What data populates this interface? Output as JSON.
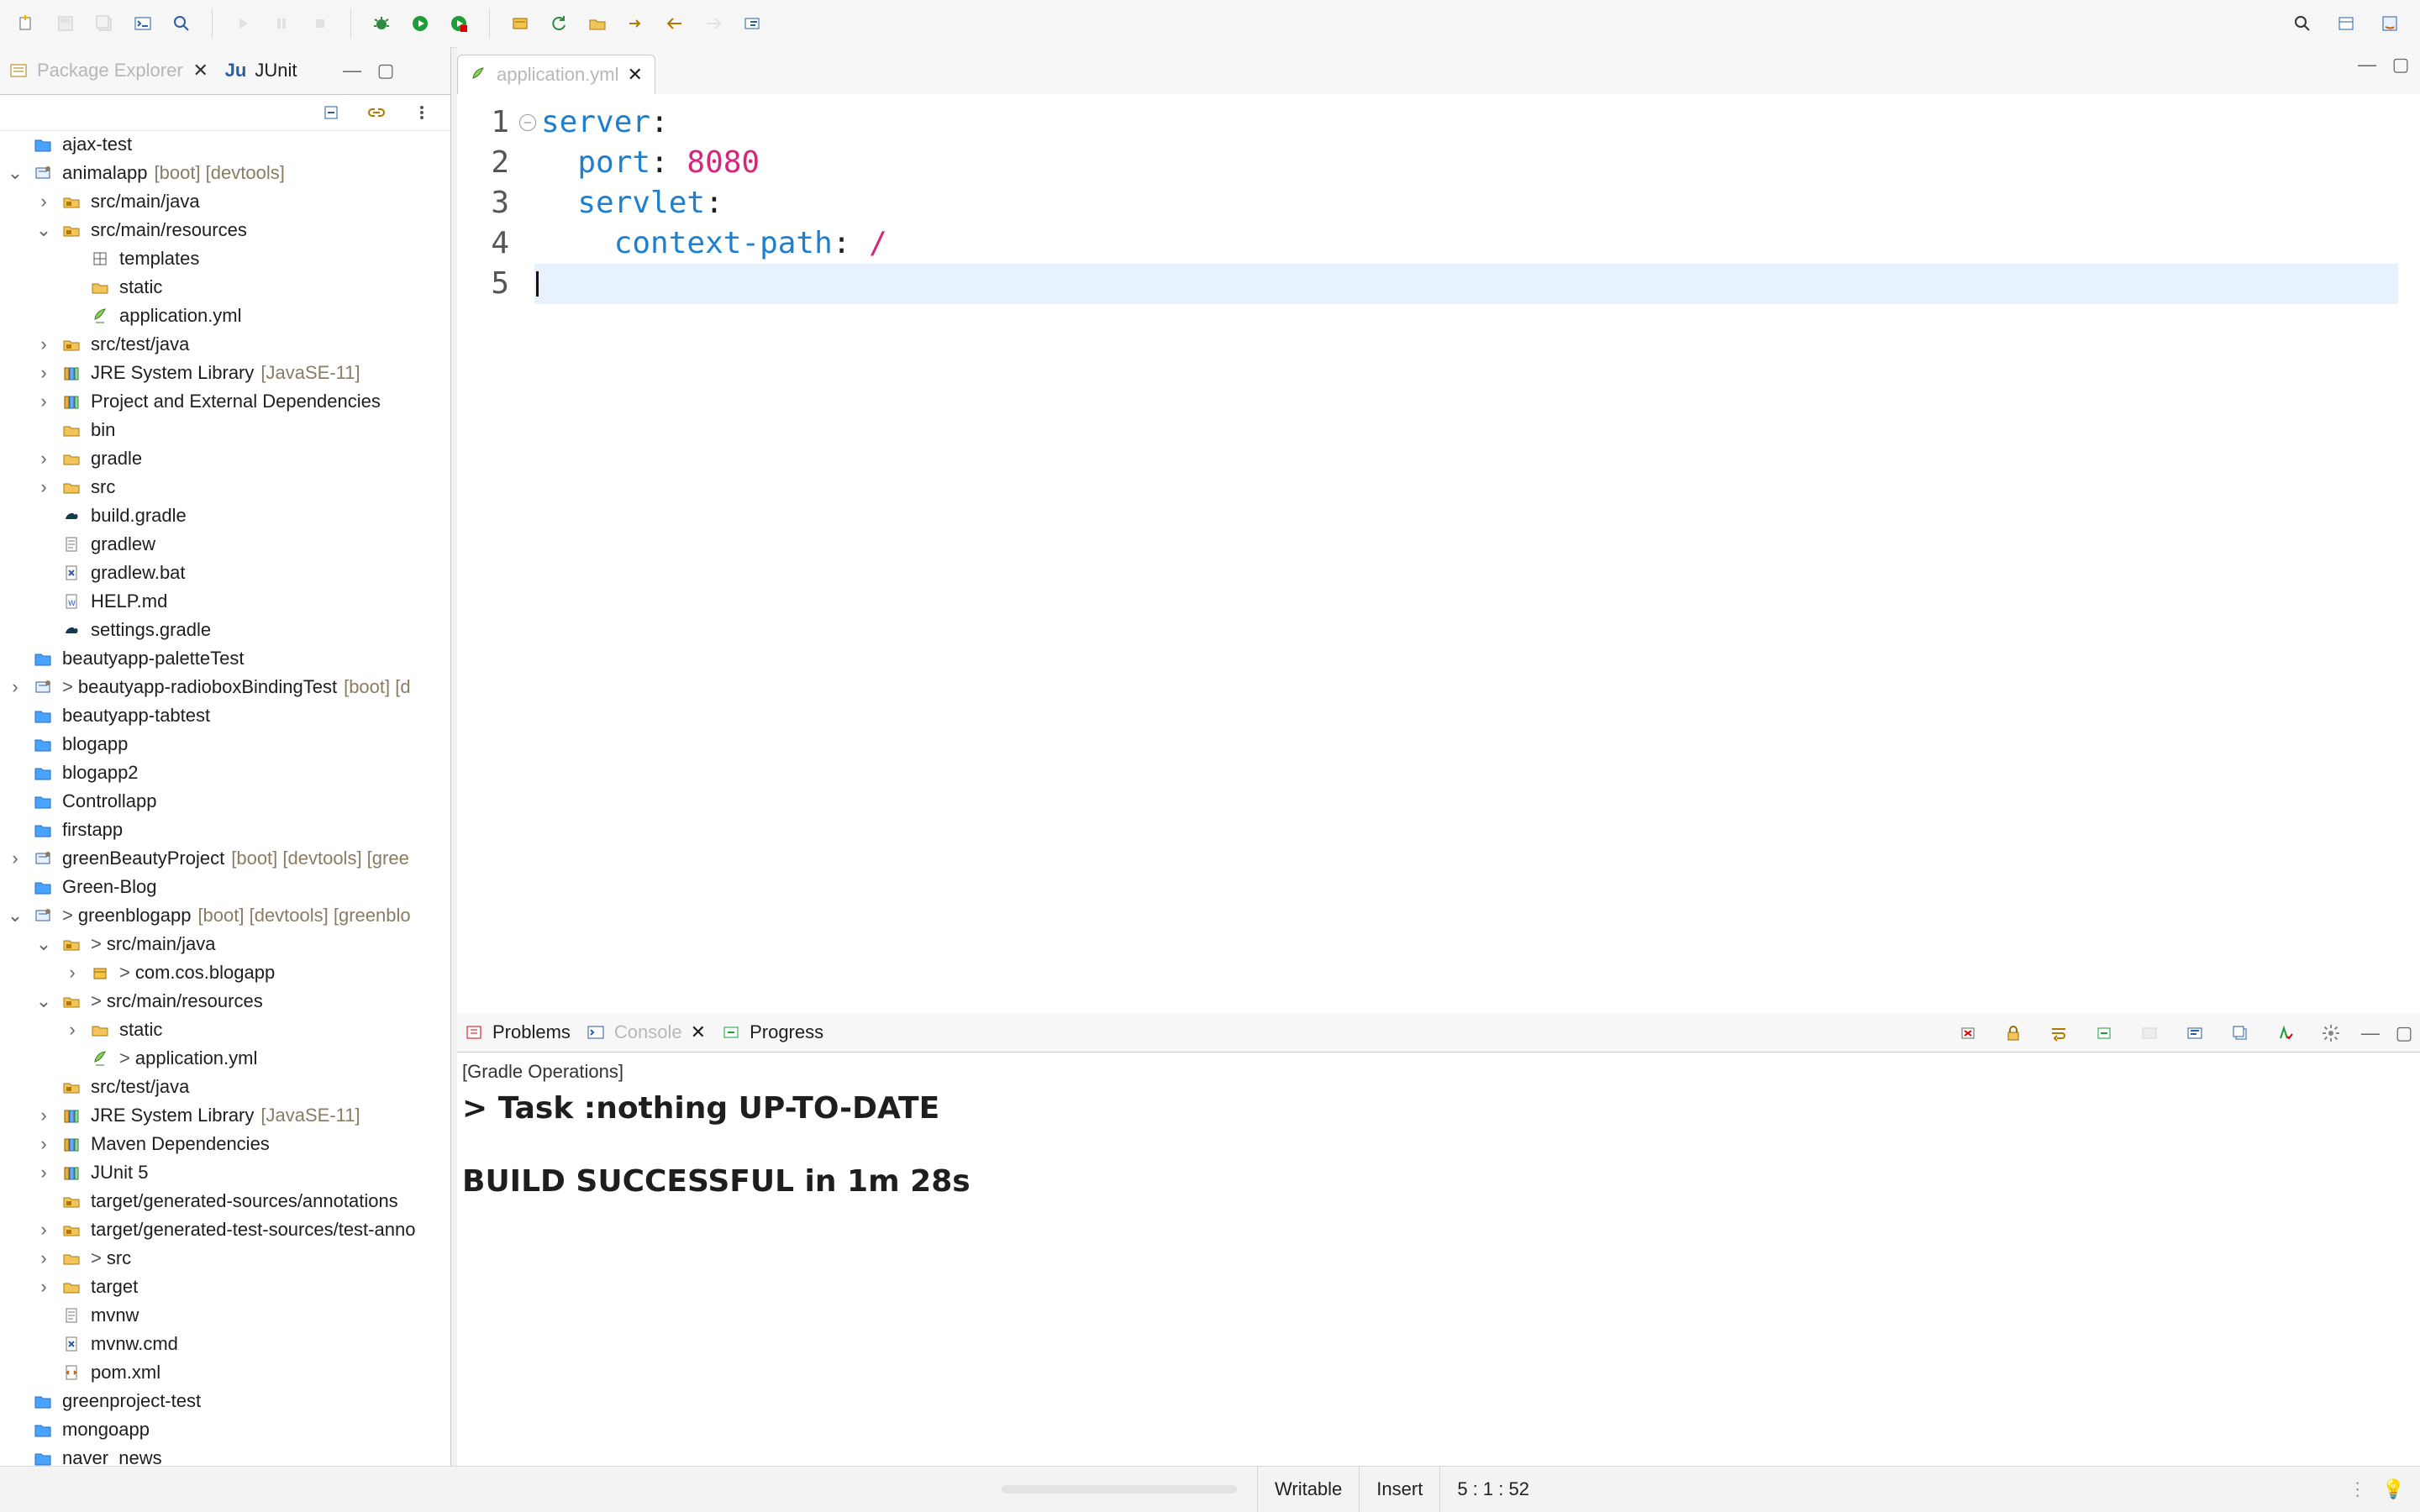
{
  "left_panel": {
    "tabs": [
      {
        "label": "Package Explorer",
        "active": false
      },
      {
        "label": "JUnit",
        "active": true
      }
    ],
    "tree": [
      {
        "indent": 0,
        "caret": "",
        "icon": "folder-icon",
        "prefix": "",
        "label": "ajax-test",
        "badge": ""
      },
      {
        "indent": 0,
        "caret": "down",
        "icon": "project-icon",
        "prefix": "",
        "label": "animalapp",
        "badge": "[boot] [devtools]"
      },
      {
        "indent": 1,
        "caret": "right",
        "icon": "package-folder-icon",
        "prefix": "",
        "label": "src/main/java",
        "badge": ""
      },
      {
        "indent": 1,
        "caret": "down",
        "icon": "package-folder-icon",
        "prefix": "",
        "label": "src/main/resources",
        "badge": ""
      },
      {
        "indent": 2,
        "caret": "",
        "icon": "grid-icon",
        "prefix": "",
        "label": "templates",
        "badge": ""
      },
      {
        "indent": 2,
        "caret": "",
        "icon": "folder-open-icon",
        "prefix": "",
        "label": "static",
        "badge": ""
      },
      {
        "indent": 2,
        "caret": "",
        "icon": "yml-icon",
        "prefix": "",
        "label": "application.yml",
        "badge": ""
      },
      {
        "indent": 1,
        "caret": "right",
        "icon": "package-folder-icon",
        "prefix": "",
        "label": "src/test/java",
        "badge": ""
      },
      {
        "indent": 1,
        "caret": "right",
        "icon": "library-icon",
        "prefix": "",
        "label": "JRE System Library",
        "badge": "[JavaSE-11]"
      },
      {
        "indent": 1,
        "caret": "right",
        "icon": "library-icon",
        "prefix": "",
        "label": "Project and External Dependencies",
        "badge": ""
      },
      {
        "indent": 1,
        "caret": "",
        "icon": "folder-open-icon",
        "prefix": "",
        "label": "bin",
        "badge": ""
      },
      {
        "indent": 1,
        "caret": "right",
        "icon": "folder-open-icon",
        "prefix": "",
        "label": "gradle",
        "badge": ""
      },
      {
        "indent": 1,
        "caret": "right",
        "icon": "folder-open-icon",
        "prefix": "",
        "label": "src",
        "badge": ""
      },
      {
        "indent": 1,
        "caret": "",
        "icon": "gradle-icon",
        "prefix": "",
        "label": "build.gradle",
        "badge": ""
      },
      {
        "indent": 1,
        "caret": "",
        "icon": "file-icon",
        "prefix": "",
        "label": "gradlew",
        "badge": ""
      },
      {
        "indent": 1,
        "caret": "",
        "icon": "bat-icon",
        "prefix": "",
        "label": "gradlew.bat",
        "badge": ""
      },
      {
        "indent": 1,
        "caret": "",
        "icon": "word-icon",
        "prefix": "",
        "label": "HELP.md",
        "badge": ""
      },
      {
        "indent": 1,
        "caret": "",
        "icon": "gradle-icon",
        "prefix": "",
        "label": "settings.gradle",
        "badge": ""
      },
      {
        "indent": 0,
        "caret": "",
        "icon": "folder-icon",
        "prefix": "",
        "label": "beautyapp-paletteTest",
        "badge": ""
      },
      {
        "indent": 0,
        "caret": "right",
        "icon": "project-icon",
        "prefix": ">",
        "label": "beautyapp-radioboxBindingTest",
        "badge": "[boot] [d"
      },
      {
        "indent": 0,
        "caret": "",
        "icon": "folder-icon",
        "prefix": "",
        "label": "beautyapp-tabtest",
        "badge": ""
      },
      {
        "indent": 0,
        "caret": "",
        "icon": "folder-icon",
        "prefix": "",
        "label": "blogapp",
        "badge": ""
      },
      {
        "indent": 0,
        "caret": "",
        "icon": "folder-icon",
        "prefix": "",
        "label": "blogapp2",
        "badge": ""
      },
      {
        "indent": 0,
        "caret": "",
        "icon": "folder-icon",
        "prefix": "",
        "label": "Controllapp",
        "badge": ""
      },
      {
        "indent": 0,
        "caret": "",
        "icon": "folder-icon",
        "prefix": "",
        "label": "firstapp",
        "badge": ""
      },
      {
        "indent": 0,
        "caret": "right",
        "icon": "project-icon",
        "prefix": "",
        "label": "greenBeautyProject",
        "badge": "[boot] [devtools] [gree"
      },
      {
        "indent": 0,
        "caret": "",
        "icon": "folder-icon",
        "prefix": "",
        "label": "Green-Blog",
        "badge": ""
      },
      {
        "indent": 0,
        "caret": "down",
        "icon": "project-icon",
        "prefix": ">",
        "label": "greenblogapp",
        "badge": "[boot] [devtools] [greenblo"
      },
      {
        "indent": 1,
        "caret": "down",
        "icon": "package-folder-icon",
        "prefix": ">",
        "label": "src/main/java",
        "badge": ""
      },
      {
        "indent": 2,
        "caret": "right",
        "icon": "package-icon",
        "prefix": ">",
        "label": "com.cos.blogapp",
        "badge": ""
      },
      {
        "indent": 1,
        "caret": "down",
        "icon": "package-folder-icon",
        "prefix": ">",
        "label": "src/main/resources",
        "badge": ""
      },
      {
        "indent": 2,
        "caret": "right",
        "icon": "folder-open-icon",
        "prefix": "",
        "label": "static",
        "badge": ""
      },
      {
        "indent": 2,
        "caret": "",
        "icon": "yml-icon",
        "prefix": ">",
        "label": "application.yml",
        "badge": ""
      },
      {
        "indent": 1,
        "caret": "",
        "icon": "package-folder-icon",
        "prefix": "",
        "label": "src/test/java",
        "badge": ""
      },
      {
        "indent": 1,
        "caret": "right",
        "icon": "library-icon",
        "prefix": "",
        "label": "JRE System Library",
        "badge": "[JavaSE-11]"
      },
      {
        "indent": 1,
        "caret": "right",
        "icon": "library-icon",
        "prefix": "",
        "label": "Maven Dependencies",
        "badge": ""
      },
      {
        "indent": 1,
        "caret": "right",
        "icon": "library-icon",
        "prefix": "",
        "label": "JUnit 5",
        "badge": ""
      },
      {
        "indent": 1,
        "caret": "",
        "icon": "package-folder-icon",
        "prefix": "",
        "label": "target/generated-sources/annotations",
        "badge": ""
      },
      {
        "indent": 1,
        "caret": "right",
        "icon": "package-folder-icon",
        "prefix": "",
        "label": "target/generated-test-sources/test-anno",
        "badge": ""
      },
      {
        "indent": 1,
        "caret": "right",
        "icon": "folder-open-icon",
        "prefix": ">",
        "label": "src",
        "badge": ""
      },
      {
        "indent": 1,
        "caret": "right",
        "icon": "folder-open-icon",
        "prefix": "",
        "label": "target",
        "badge": ""
      },
      {
        "indent": 1,
        "caret": "",
        "icon": "file-icon",
        "prefix": "",
        "label": "mvnw",
        "badge": ""
      },
      {
        "indent": 1,
        "caret": "",
        "icon": "bat-icon",
        "prefix": "",
        "label": "mvnw.cmd",
        "badge": ""
      },
      {
        "indent": 1,
        "caret": "",
        "icon": "xml-icon",
        "prefix": "",
        "label": "pom.xml",
        "badge": ""
      },
      {
        "indent": 0,
        "caret": "",
        "icon": "folder-icon",
        "prefix": "",
        "label": "greenproject-test",
        "badge": ""
      },
      {
        "indent": 0,
        "caret": "",
        "icon": "folder-icon",
        "prefix": "",
        "label": "mongoapp",
        "badge": ""
      },
      {
        "indent": 0,
        "caret": "",
        "icon": "folder-icon",
        "prefix": "",
        "label": "naver_news",
        "badge": ""
      }
    ]
  },
  "editor": {
    "tab_label": "application.yml",
    "lines": [
      {
        "n": "1",
        "text": "server:",
        "fold": true
      },
      {
        "n": "2",
        "text": "  port: 8080",
        "fold": false
      },
      {
        "n": "3",
        "text": "  servlet:",
        "fold": false
      },
      {
        "n": "4",
        "text": "    context-path: /",
        "fold": false
      },
      {
        "n": "5",
        "text": "",
        "fold": false
      }
    ]
  },
  "bottom": {
    "tabs": [
      {
        "label": "Problems",
        "active": false
      },
      {
        "label": "Console",
        "active": true
      },
      {
        "label": "Progress",
        "active": false
      }
    ],
    "console_header": "[Gradle Operations]",
    "console_lines": [
      "> Task :nothing UP-TO-DATE",
      "",
      "BUILD SUCCESSFUL in 1m 28s"
    ]
  },
  "status": {
    "writable": "Writable",
    "insert": "Insert",
    "position": "5 : 1 : 52"
  },
  "colors": {
    "yaml_key": "#1f7fcf",
    "yaml_value": "#d7267a",
    "badge": "#8a7b63"
  }
}
